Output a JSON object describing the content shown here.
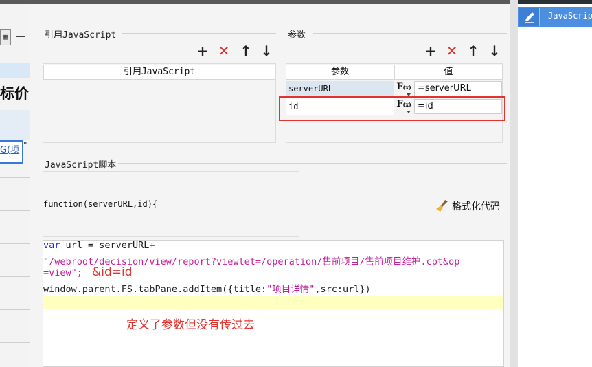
{
  "left_strip": {
    "toolbar_glyph": "▦",
    "cell_text": "标价",
    "link_text": "G(项",
    "quote": "\""
  },
  "dialog": {
    "js_ref": {
      "title": "引用JavaScript",
      "column_header": "引用JavaScript",
      "toolbar": {
        "add": "+",
        "delete": "✕",
        "up": "↑",
        "down": "↓"
      }
    },
    "params": {
      "title": "参数",
      "toolbar": {
        "add": "+",
        "delete": "✕",
        "up": "↑",
        "down": "↓"
      },
      "columns": [
        "参数",
        "值"
      ],
      "rows": [
        {
          "name": "serverURL",
          "fx": "F",
          "fx_sub": "(x)",
          "value": "=serverURL"
        },
        {
          "name": "id",
          "fx": "F",
          "fx_sub": "(x)",
          "value": "=id"
        }
      ]
    },
    "script": {
      "title": "JavaScript脚本",
      "signature": "function(serverURL,id){",
      "format_label": "格式化代码",
      "code": {
        "line1_kw": "var",
        "line1_rest": " url = serverURL+",
        "line2": "\"/webroot/decision/view/report?viewlet=/operation/售前项目/售前项目维护.cpt&op",
        "line3": "=view\";",
        "line4_a": "window.parent.FS.tabPane.addItem({title:",
        "line4_b": "\"项目详情\"",
        "line4_c": ",src:url})"
      },
      "annotations": {
        "suggestion": "&id=id",
        "note": "定义了参数但没有传过去"
      }
    }
  },
  "right_panel": {
    "tab_label": "JavaScrip",
    "tab_icon": "pencil-icon"
  },
  "colors": {
    "accent_blue": "#4c8fe0",
    "red": "#e3332f",
    "selected_row": "#dce6f1",
    "highlight_line": "#ffffc0"
  }
}
